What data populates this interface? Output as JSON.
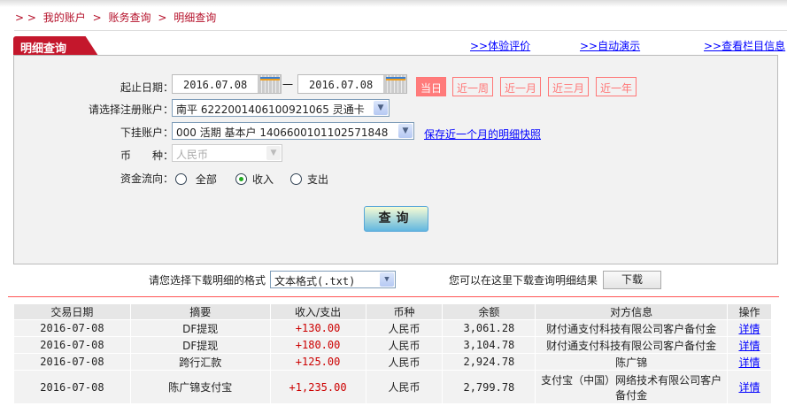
{
  "breadcrumb": [
    "> >",
    "我的账户",
    ">",
    "账务查询",
    ">",
    "明细查询"
  ],
  "tab_title": "明细查询",
  "top_links": [
    ">>体验评价",
    ">>自动演示",
    ">>查看栏目信息"
  ],
  "form": {
    "date_label": "起止日期：",
    "start_date": "2016.07.08",
    "dash": "一",
    "end_date": "2016.07.08",
    "quick_ranges": [
      "当日",
      "近一周",
      "近一月",
      "近三月",
      "近一年"
    ],
    "quick_selected": "当日",
    "reg_account_label": "请选择注册账户：",
    "reg_account_value": "南平 6222001406100921065 灵通卡",
    "sub_account_label": "下挂账户：",
    "sub_account_value": "000 活期 基本户 1406600101102571848",
    "snapshot_link": "保存近一个月的明细快照",
    "currency_label": "币　　种：",
    "currency_value": "人民币",
    "flow_label": "资金流向：",
    "flow_options": [
      "全部",
      "收入",
      "支出"
    ],
    "flow_selected": "收入",
    "query_button": "查询"
  },
  "download": {
    "format_label": "请您选择下载明细的格式",
    "format_value": "文本格式(.txt)",
    "hint": "您可以在这里下载查询明细结果",
    "button": "下载"
  },
  "table": {
    "headers": [
      "交易日期",
      "摘要",
      "收入/支出",
      "币种",
      "余额",
      "对方信息",
      "操作"
    ],
    "rows": [
      [
        "2016-07-08",
        "DF提现",
        "+130.00",
        "人民币",
        "3,061.28",
        "财付通支付科技有限公司客户备付金",
        "详情"
      ],
      [
        "2016-07-08",
        "DF提现",
        "+180.00",
        "人民币",
        "3,104.78",
        "财付通支付科技有限公司客户备付金",
        "详情"
      ],
      [
        "2016-07-08",
        "跨行汇款",
        "+125.00",
        "人民币",
        "2,924.78",
        "陈广锦",
        "详情"
      ],
      [
        "2016-07-08",
        "陈广锦支付宝",
        "+1,235.00",
        "人民币",
        "2,799.78",
        "支付宝（中国）网络技术有限公司客户备付金",
        "详情"
      ]
    ]
  },
  "colors": {
    "brand": "#c4172c",
    "amount": "#cc0000",
    "link": "#0000ff"
  }
}
